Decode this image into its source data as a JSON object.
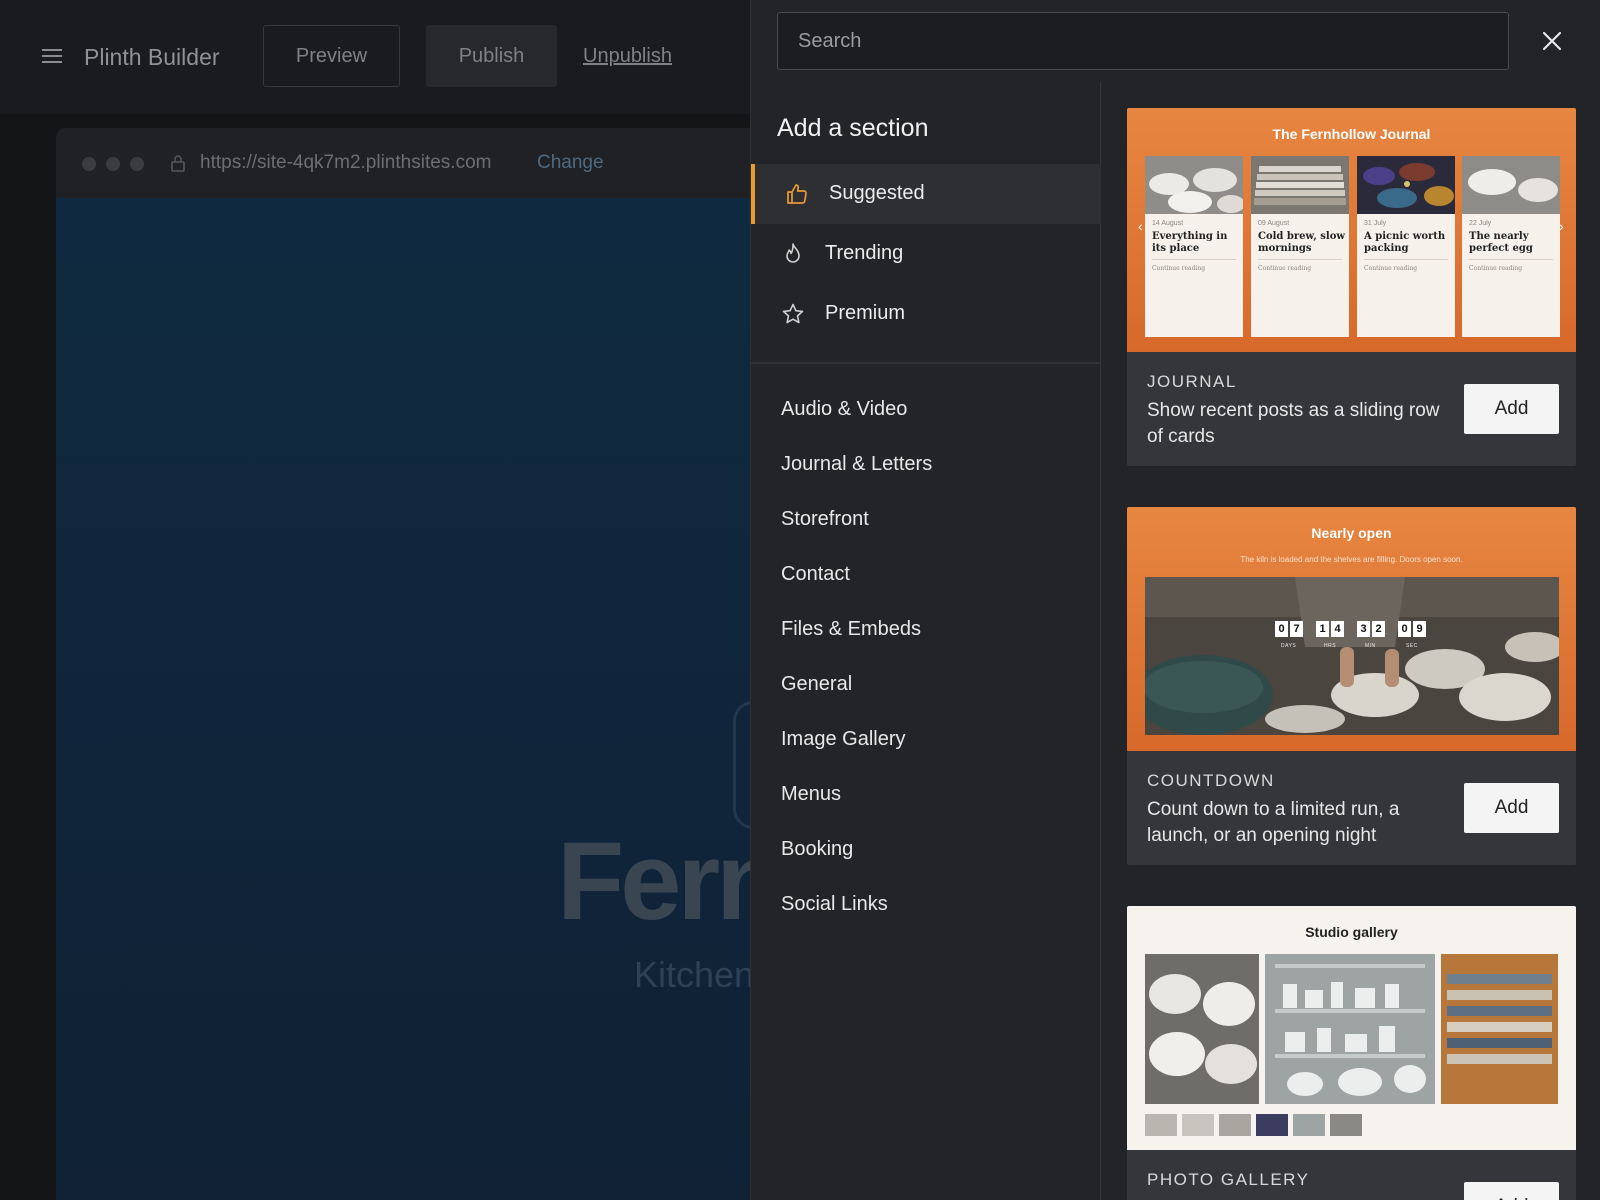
{
  "app": {
    "title": "Plinth Builder",
    "preview_label": "Preview",
    "publish_label": "Publish",
    "unpublish_label": "Unpublish"
  },
  "browser": {
    "url": "https://site-4qk7m2.plinthsites.com",
    "change_label": "Change"
  },
  "site": {
    "hero_title": "Fern",
    "hero_subtitle": "Kitchen"
  },
  "drawer": {
    "search_placeholder": "Search",
    "title": "Add a section",
    "featured": [
      {
        "label": "Suggested",
        "icon": "thumbs-up-icon",
        "active": true
      },
      {
        "label": "Trending",
        "icon": "flame-icon",
        "active": false
      },
      {
        "label": "Premium",
        "icon": "star-icon",
        "active": false
      }
    ],
    "categories": [
      "Audio & Video",
      "Journal & Letters",
      "Storefront",
      "Contact",
      "Files & Embeds",
      "General",
      "Image Gallery",
      "Menus",
      "Booking",
      "Social Links"
    ],
    "accent_color": "#e99a36"
  },
  "cards": [
    {
      "type": "JOURNAL",
      "description": "Show recent posts as a sliding row of cards",
      "add_label": "Add",
      "preview": {
        "title": "The Fernhollow Journal",
        "posts": [
          {
            "date": "14 August",
            "title": "Everything in its place",
            "more": "Continue reading"
          },
          {
            "date": "09 August",
            "title": "Cold brew, slow mornings",
            "more": "Continue reading"
          },
          {
            "date": "31 July",
            "title": "A picnic worth packing",
            "more": "Continue reading"
          },
          {
            "date": "22 July",
            "title": "The nearly perfect egg",
            "more": "Continue reading"
          }
        ]
      }
    },
    {
      "type": "COUNTDOWN",
      "description": "Count down to a limited run, a launch, or an opening night",
      "add_label": "Add",
      "preview": {
        "title": "Nearly open",
        "subtitle": "The kiln is loaded and the shelves are filling. Doors open soon.",
        "units": [
          {
            "value": "07",
            "label": "DAYS"
          },
          {
            "value": "14",
            "label": "HRS"
          },
          {
            "value": "32",
            "label": "MIN"
          },
          {
            "value": "09",
            "label": "SEC"
          }
        ]
      }
    },
    {
      "type": "PHOTO GALLERY",
      "description": "",
      "add_label": "Add",
      "preview": {
        "title": "Studio gallery"
      }
    }
  ]
}
